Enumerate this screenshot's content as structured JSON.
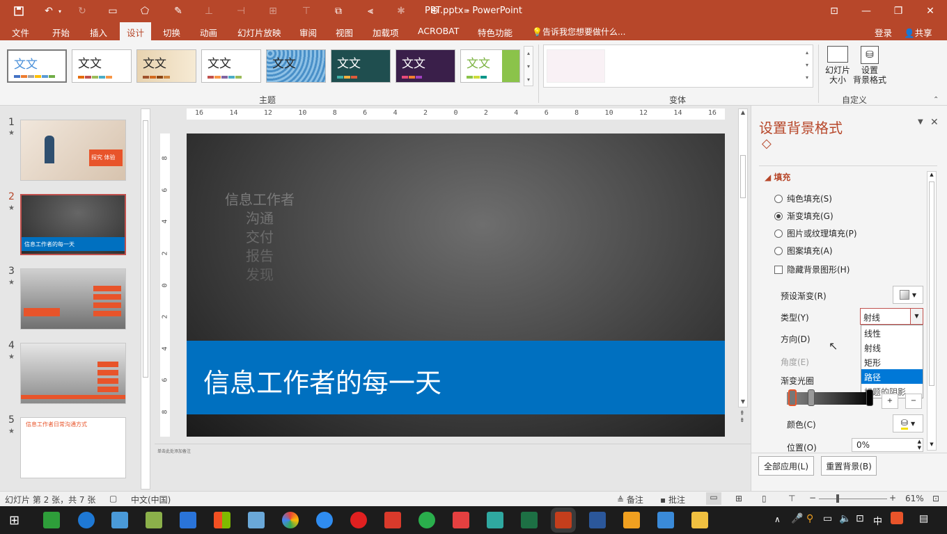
{
  "titlebar": {
    "title": "PPT.pptx - PowerPoint"
  },
  "menu": {
    "items": [
      "文件",
      "开始",
      "插入",
      "设计",
      "切换",
      "动画",
      "幻灯片放映",
      "审阅",
      "视图",
      "加载项",
      "ACROBAT",
      "特色功能"
    ],
    "active": "设计",
    "tell_me": "告诉我您想要做什么...",
    "login": "登录",
    "share": "共享"
  },
  "ribbon": {
    "themes_label": "主题",
    "variants_label": "变体",
    "customize_label": "自定义",
    "theme_text": "文文",
    "slide_size": "幻灯片\n大小",
    "slide_size_l1": "幻灯片",
    "slide_size_l2": "大小",
    "format_bg_l1": "设置",
    "format_bg_l2": "背景格式"
  },
  "slides": [
    {
      "num": "1",
      "text": "探究 体验"
    },
    {
      "num": "2",
      "text": "信息工作者的每一天"
    },
    {
      "num": "3"
    },
    {
      "num": "4"
    },
    {
      "num": "5",
      "text": "信息工作者日常沟通方式"
    }
  ],
  "slide": {
    "list": [
      "信息工作者",
      "沟通",
      "交付",
      "报告",
      "发现"
    ],
    "banner": "信息工作者的每一天"
  },
  "notes_placeholder": "单击此处添加备注",
  "ruler_h": [
    "16",
    "14",
    "12",
    "10",
    "8",
    "6",
    "4",
    "2",
    "0",
    "2",
    "4",
    "6",
    "8",
    "10",
    "12",
    "14",
    "16"
  ],
  "ruler_v": [
    "8",
    "6",
    "4",
    "2",
    "0",
    "2",
    "4",
    "6",
    "8"
  ],
  "pane": {
    "title": "设置背景格式",
    "section": "填充",
    "fill_options": [
      "纯色填充(S)",
      "渐变填充(G)",
      "图片或纹理填充(P)",
      "图案填充(A)"
    ],
    "selected_fill": "渐变填充(G)",
    "hide_bg": "隐藏背景图形(H)",
    "preset": "预设渐变(R)",
    "type": "类型(Y)",
    "type_value": "射线",
    "direction": "方向(D)",
    "angle": "角度(E)",
    "stops": "渐变光圈",
    "color": "颜色(C)",
    "position": "位置(O)",
    "position_value": "0%",
    "dropdown_options": [
      "线性",
      "射线",
      "矩形",
      "路径",
      "标题的阴影"
    ],
    "dropdown_highlight": "路径",
    "apply_all": "全部应用(L)",
    "reset": "重置背景(B)"
  },
  "status": {
    "slide_info": "幻灯片 第 2 张，共 7 张",
    "lang": "中文(中国)",
    "notes": "备注",
    "comments": "批注",
    "zoom": "61%"
  },
  "taskbar": {
    "ime": "中"
  },
  "colors": {
    "accent": "#b7472a",
    "blue": "#0070c0",
    "highlight": "#0078d7"
  }
}
